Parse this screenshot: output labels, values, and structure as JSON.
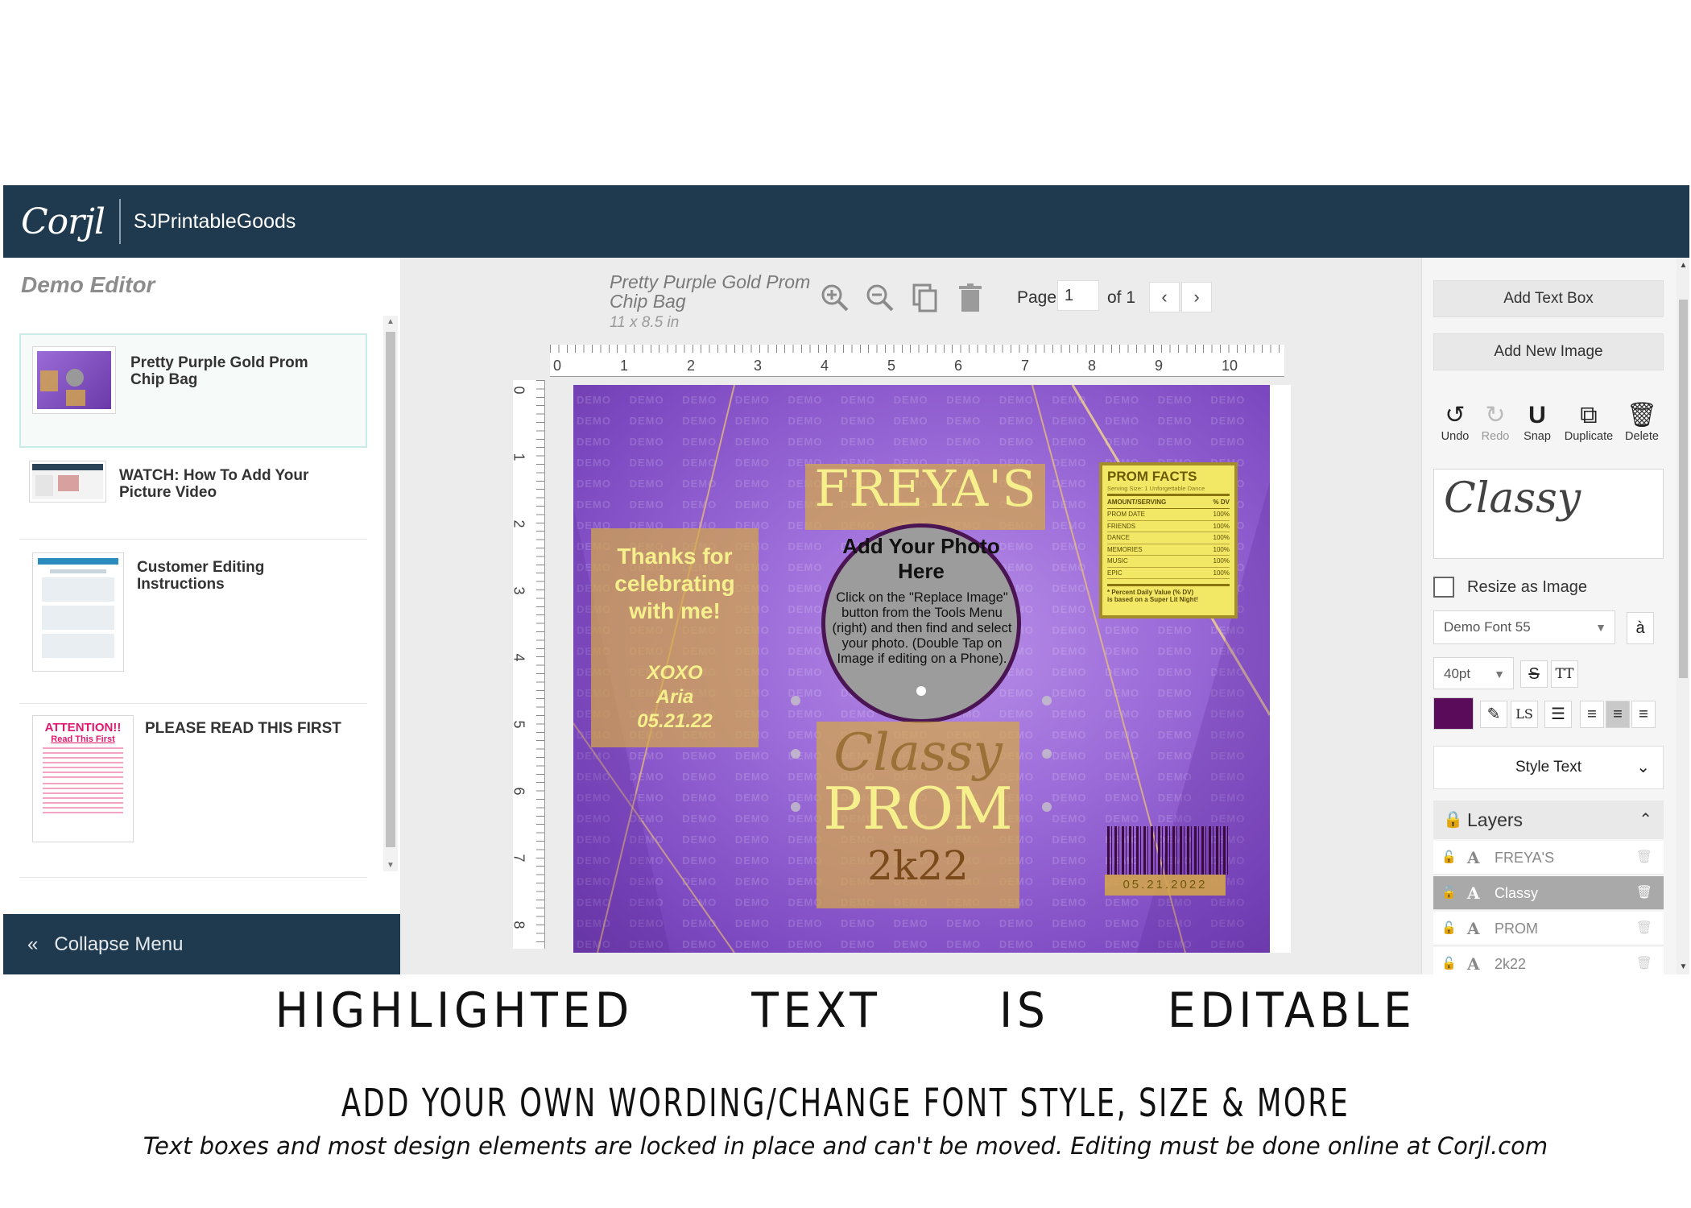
{
  "header": {
    "logo": "Corjl",
    "shop_name": "SJPrintableGoods"
  },
  "sidebar": {
    "title": "Demo Editor",
    "items": [
      {
        "label": "Pretty Purple Gold Prom Chip Bag"
      },
      {
        "label": "WATCH: How To Add Your Picture Video"
      },
      {
        "label": "Customer Editing Instructions"
      },
      {
        "label": "PLEASE READ THIS FIRST"
      }
    ],
    "attention_thumb": {
      "line1": "ATTENTION!!",
      "line2": "Read This First"
    },
    "collapse_label": "Collapse Menu"
  },
  "document": {
    "title": "Pretty Purple Gold Prom Chip Bag",
    "size": "11 x 8.5 in",
    "page_label": "Page",
    "page_value": "1",
    "page_of": "of 1"
  },
  "rulers": {
    "horizontal": [
      "0",
      "1",
      "2",
      "3",
      "4",
      "5",
      "6",
      "7",
      "8",
      "9",
      "10"
    ],
    "vertical": [
      "0",
      "1",
      "2",
      "3",
      "4",
      "5",
      "6",
      "7",
      "8"
    ]
  },
  "artwork": {
    "watermark": "DEMO",
    "name": "FREYA'S",
    "thanks": "Thanks for celebrating with me!",
    "xoxo": "XOXO",
    "signer": "Aria",
    "date": "05.21.22",
    "photo_heading": "Add Your Photo Here",
    "photo_instructions": "Click on the \"Replace Image\" button from the Tools Menu (right) and then find and select your photo. (Double Tap on Image if editing on a Phone).",
    "script_word": "Classy",
    "prom": "PROM",
    "year": "2k22",
    "barcode_text": "05.21.2022",
    "facts": {
      "title": "PROM FACTS",
      "serving": "Serving Size: 1 Unforgettable Dance",
      "col1": "AMOUNT/SERVING",
      "col2": "% DV",
      "rows": [
        {
          "k": "PROM DATE",
          "v": "100%"
        },
        {
          "k": "FRIENDS",
          "v": "100%"
        },
        {
          "k": "DANCE",
          "v": "100%"
        },
        {
          "k": "MEMORIES",
          "v": "100%"
        },
        {
          "k": "MUSIC",
          "v": "100%"
        },
        {
          "k": "EPIC",
          "v": "100%"
        }
      ],
      "note1": "* Percent Daily Value (% DV)",
      "note2": "is based on a Super Lit Night!"
    }
  },
  "tools": {
    "add_text": "Add Text Box",
    "add_image": "Add New Image",
    "actions": [
      {
        "label": "Undo",
        "icon": "undo-icon"
      },
      {
        "label": "Redo",
        "icon": "redo-icon"
      },
      {
        "label": "Snap",
        "icon": "magnet-icon"
      },
      {
        "label": "Duplicate",
        "icon": "duplicate-icon"
      },
      {
        "label": "Delete",
        "icon": "trash-icon"
      }
    ],
    "preview_text": "Classy",
    "resize_label": "Resize as Image",
    "font": "Demo Font 55",
    "size": "40pt",
    "color": "#5a0b5a",
    "style_text": "Style Text",
    "layers_title": "Layers",
    "layers": [
      {
        "name": "FREYA'S",
        "selected": false
      },
      {
        "name": "Classy",
        "selected": true
      },
      {
        "name": "PROM",
        "selected": false
      },
      {
        "name": "2k22",
        "selected": false
      }
    ]
  },
  "captions": {
    "line1": "HIGHLIGHTED   TEXT   IS   EDITABLE",
    "line2": "ADD YOUR OWN WORDING/CHANGE FONT STYLE, SIZE & MORE",
    "line3": "Text boxes and most design elements are locked in place and can't be moved. Editing must be done online at Corjl.com"
  },
  "colors": {
    "navbar": "#1f3a4f",
    "purple": "#9b6bd8",
    "gold": "#d6a848",
    "text_color": "#5a0b5a"
  }
}
